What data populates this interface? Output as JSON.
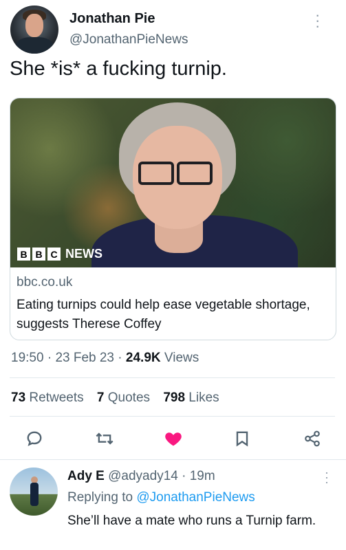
{
  "tweet": {
    "author_name": "Jonathan Pie",
    "author_handle": "@JonathanPieNews",
    "text": "She *is* a fucking turnip.",
    "card": {
      "image_logo_text": "NEWS",
      "bbc_letters": [
        "B",
        "B",
        "C"
      ],
      "domain": "bbc.co.uk",
      "title": "Eating turnips could help ease vegetable shortage, suggests Therese Coffey"
    },
    "meta": {
      "time": "19:50",
      "separator": "·",
      "date": "23 Feb 23",
      "views_count": "24.9K",
      "views_label": "Views"
    },
    "stats": {
      "retweets_count": "73",
      "retweets_label": "Retweets",
      "quotes_count": "7",
      "quotes_label": "Quotes",
      "likes_count": "798",
      "likes_label": "Likes"
    },
    "actions": {
      "reply_icon": "reply-icon",
      "retweet_icon": "retweet-icon",
      "like_icon": "heart-icon",
      "bookmark_icon": "bookmark-icon",
      "share_icon": "share-icon"
    },
    "colors": {
      "like_active": "#f91880",
      "link": "#1d9bf0",
      "secondary_text": "#536471"
    }
  },
  "reply": {
    "author_name": "Ady E",
    "author_handle": "@adyady14",
    "separator": "·",
    "time": "19m",
    "replying_to_label": "Replying to",
    "replying_to_handle": "@JonathanPieNews",
    "text": "She’ll have a mate who runs a Turnip farm."
  }
}
